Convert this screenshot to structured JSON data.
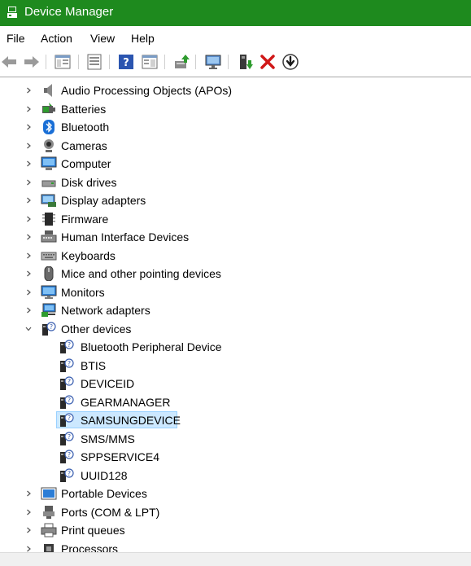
{
  "window": {
    "title": "Device Manager"
  },
  "menu": [
    "File",
    "Action",
    "View",
    "Help"
  ],
  "toolbar": {
    "buttons": [
      {
        "name": "back-arrow-icon"
      },
      {
        "name": "forward-arrow-icon"
      },
      {
        "name": "show-hide-console-tree-icon"
      },
      {
        "name": "properties-icon"
      },
      {
        "name": "help-icon"
      },
      {
        "name": "action-pane-icon"
      },
      {
        "name": "update-driver-icon"
      },
      {
        "name": "scan-hardware-icon"
      },
      {
        "name": "enable-device-icon"
      },
      {
        "name": "uninstall-device-icon"
      },
      {
        "name": "disable-device-icon"
      }
    ]
  },
  "tree": {
    "categories": [
      {
        "label": "Audio Processing Objects (APOs)",
        "icon": "speaker-icon",
        "expanded": false
      },
      {
        "label": "Batteries",
        "icon": "battery-icon",
        "expanded": false
      },
      {
        "label": "Bluetooth",
        "icon": "bluetooth-icon",
        "expanded": false
      },
      {
        "label": "Cameras",
        "icon": "camera-icon",
        "expanded": false
      },
      {
        "label": "Computer",
        "icon": "computer-icon",
        "expanded": false
      },
      {
        "label": "Disk drives",
        "icon": "disk-drive-icon",
        "expanded": false
      },
      {
        "label": "Display adapters",
        "icon": "display-adapter-icon",
        "expanded": false
      },
      {
        "label": "Firmware",
        "icon": "firmware-chip-icon",
        "expanded": false
      },
      {
        "label": "Human Interface Devices",
        "icon": "hid-icon",
        "expanded": false
      },
      {
        "label": "Keyboards",
        "icon": "keyboard-icon",
        "expanded": false
      },
      {
        "label": "Mice and other pointing devices",
        "icon": "mouse-icon",
        "expanded": false
      },
      {
        "label": "Monitors",
        "icon": "monitor-icon",
        "expanded": false
      },
      {
        "label": "Network adapters",
        "icon": "network-adapter-icon",
        "expanded": false
      },
      {
        "label": "Other devices",
        "icon": "unknown-device-icon",
        "expanded": true,
        "children": [
          {
            "label": "Bluetooth Peripheral Device",
            "selected": false
          },
          {
            "label": "BTIS",
            "selected": false
          },
          {
            "label": "DEVICEID",
            "selected": false
          },
          {
            "label": "GEARMANAGER",
            "selected": false
          },
          {
            "label": "SAMSUNGDEVICE",
            "selected": true
          },
          {
            "label": "SMS/MMS",
            "selected": false
          },
          {
            "label": "SPPSERVICE4",
            "selected": false
          },
          {
            "label": "UUID128",
            "selected": false
          }
        ]
      },
      {
        "label": "Portable Devices",
        "icon": "portable-device-icon",
        "expanded": false
      },
      {
        "label": "Ports (COM & LPT)",
        "icon": "port-icon",
        "expanded": false
      },
      {
        "label": "Print queues",
        "icon": "printer-icon",
        "expanded": false
      },
      {
        "label": "Processors",
        "icon": "processor-icon",
        "expanded": false
      }
    ]
  },
  "colors": {
    "titlebar": "#1e8a1e",
    "selection": "#cce8ff",
    "selection_border": "#99d1ff"
  }
}
